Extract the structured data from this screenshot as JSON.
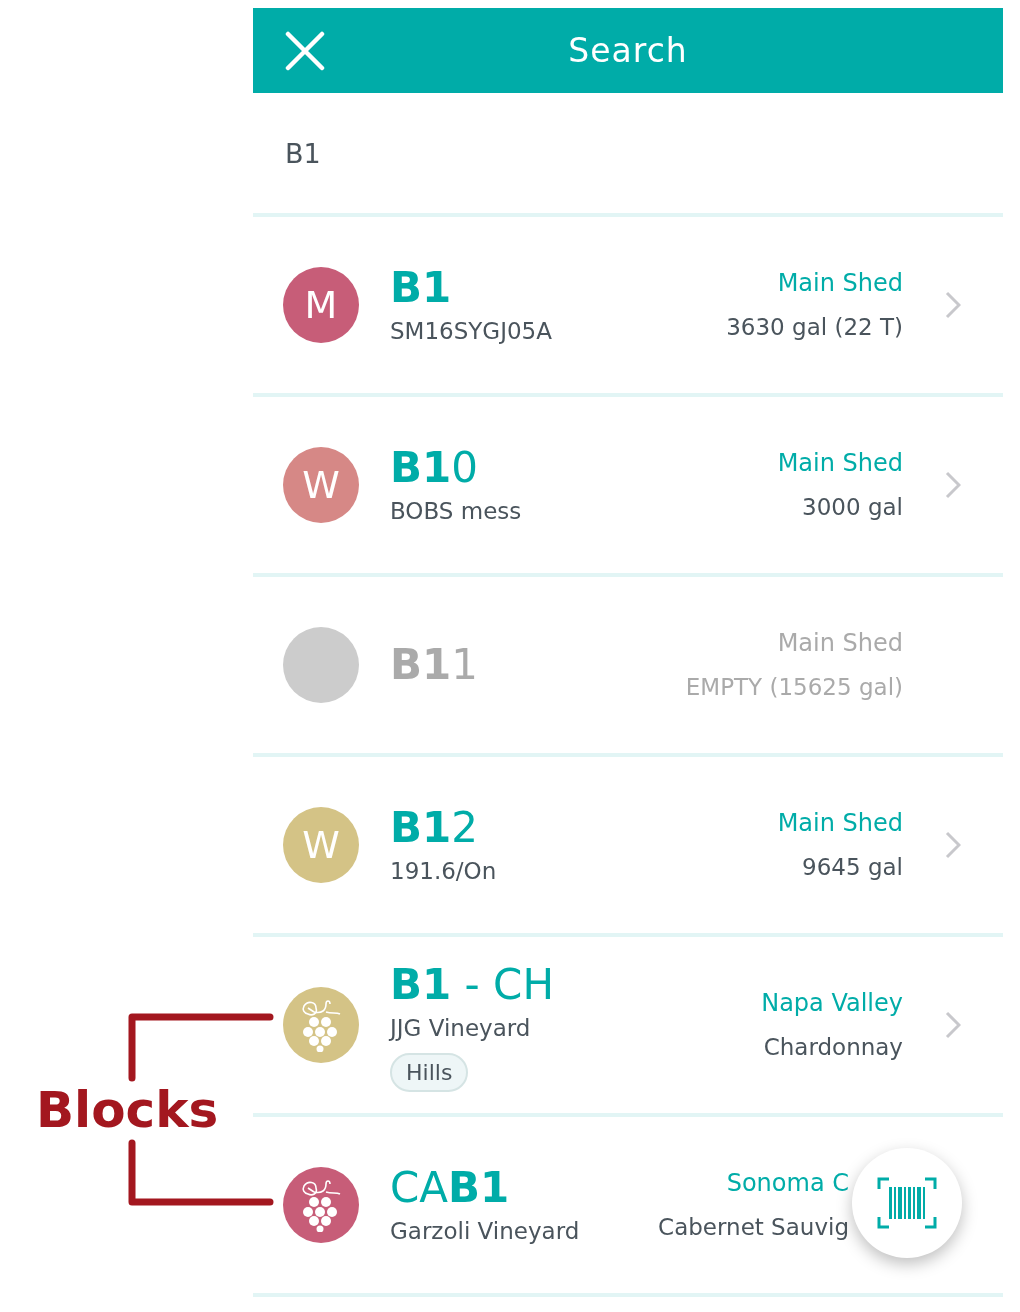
{
  "header": {
    "title": "Search"
  },
  "search": {
    "value": "B1"
  },
  "results": [
    {
      "kind": "tank",
      "title": "**B1**",
      "subtitle": "SM16SYGJ05A",
      "location": "Main Shed",
      "detail": "3630 gal (22 T)",
      "badge": "M",
      "color": "#c75d78",
      "disabled": false,
      "chevron": true
    },
    {
      "kind": "tank",
      "title": "**B1**0",
      "subtitle": "BOBS mess",
      "location": "Main Shed",
      "detail": "3000 gal",
      "badge": "W",
      "color": "#d68886",
      "disabled": false,
      "chevron": true
    },
    {
      "kind": "tank",
      "title": "**B1**1",
      "location": "Main Shed",
      "detail": "EMPTY (15625 gal)",
      "color": "#cccccc",
      "disabled": true,
      "chevron": false
    },
    {
      "kind": "tank",
      "title": "**B1**2",
      "subtitle": "191.6/On",
      "location": "Main Shed",
      "detail": "9645 gal",
      "badge": "W",
      "color": "#d4c386",
      "disabled": false,
      "chevron": true
    },
    {
      "kind": "block",
      "title": "**B1** - CH",
      "subtitle": "JJG Vineyard",
      "tag": "Hills",
      "location": "Napa Valley",
      "detail": "Chardonnay",
      "color": "#d4c386",
      "disabled": false,
      "chevron": true
    },
    {
      "kind": "block",
      "title": "CA**B1**",
      "subtitle": "Garzoli Vineyard",
      "location": "Sonoma C",
      "detail": "Cabernet Sauvig",
      "color": "#c75d78",
      "disabled": false,
      "chevron": false
    }
  ],
  "annotation": {
    "label": "Blocks"
  },
  "scan_button": {
    "kind": "barcode"
  }
}
